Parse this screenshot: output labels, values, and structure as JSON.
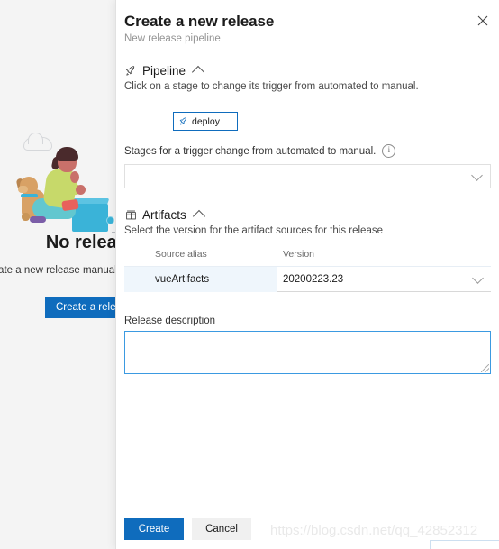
{
  "background": {
    "empty_title": "No releases",
    "empty_desc": "ate a new release manually o\nautomatically",
    "empty_button": "Create a relea"
  },
  "panel": {
    "title": "Create a new release",
    "subtitle": "New release pipeline",
    "close_icon": "close-icon",
    "pipeline": {
      "icon": "rocket-icon",
      "title": "Pipeline",
      "collapse_icon": "chevron-up-icon",
      "description": "Click on a stage to change its trigger from automated to manual.",
      "stage": {
        "icon": "rocket-icon",
        "label": "deploy"
      },
      "stages_field_label": "Stages for a trigger change from automated to manual.",
      "info_icon": "i",
      "stages_select_value": "",
      "stages_select_chevron": "chevron-down-icon"
    },
    "artifacts": {
      "icon": "package-icon",
      "title": "Artifacts",
      "collapse_icon": "chevron-up-icon",
      "description": "Select the version for the artifact sources for this release",
      "columns": [
        "Source alias",
        "Version"
      ],
      "rows": [
        {
          "alias": "vueArtifacts",
          "version": "20200223.23"
        }
      ]
    },
    "description_field": {
      "label": "Release description",
      "value": "",
      "placeholder": ""
    },
    "footer": {
      "create_label": "Create",
      "cancel_label": "Cancel"
    }
  },
  "watermark": "https://blog.csdn.net/qq_42852312",
  "colors": {
    "accent": "#0f6cbd",
    "row_highlight": "#eff6fc",
    "focus_border": "#3b9ae1"
  }
}
